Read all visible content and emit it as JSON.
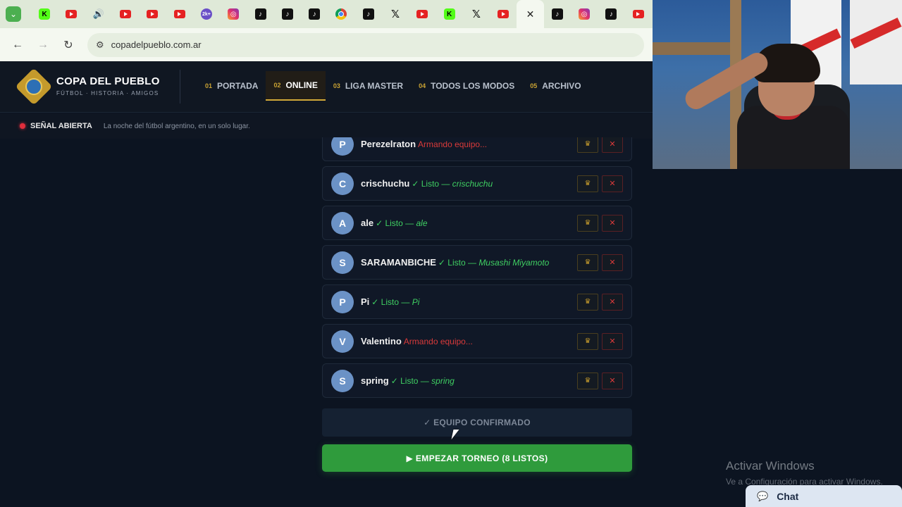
{
  "browser": {
    "tabs": [
      {
        "icon": "kick-icon",
        "type": "kick",
        "glyph": "K"
      },
      {
        "icon": "youtube-icon",
        "type": "yt",
        "glyph": ""
      },
      {
        "icon": "speaker-icon",
        "type": "spk",
        "glyph": "🔊"
      },
      {
        "icon": "youtube-icon",
        "type": "yt",
        "glyph": ""
      },
      {
        "icon": "youtube-icon",
        "type": "yt",
        "glyph": ""
      },
      {
        "icon": "youtube-icon",
        "type": "yt",
        "glyph": ""
      },
      {
        "icon": "2k-icon",
        "type": "k2",
        "glyph": "2k+"
      },
      {
        "icon": "instagram-icon",
        "type": "ig",
        "glyph": "◎"
      },
      {
        "icon": "tiktok-icon",
        "type": "tt",
        "glyph": "♪"
      },
      {
        "icon": "tiktok-icon",
        "type": "tt",
        "glyph": "♪"
      },
      {
        "icon": "tiktok-icon",
        "type": "tt",
        "glyph": "♪"
      },
      {
        "icon": "chrome-icon",
        "type": "chrome",
        "glyph": ""
      },
      {
        "icon": "tiktok-icon",
        "type": "tt",
        "glyph": "♪"
      },
      {
        "icon": "x-icon",
        "type": "x",
        "glyph": "𝕏"
      },
      {
        "icon": "youtube-icon",
        "type": "yt",
        "glyph": ""
      },
      {
        "icon": "kick-icon",
        "type": "kick",
        "glyph": "K"
      },
      {
        "icon": "x-icon",
        "type": "x",
        "glyph": "𝕏"
      },
      {
        "icon": "youtube-icon",
        "type": "yt",
        "glyph": ""
      },
      {
        "icon": "close-icon",
        "type": "close",
        "glyph": "✕",
        "active": true
      },
      {
        "icon": "tiktok-icon",
        "type": "tt",
        "glyph": "♪"
      },
      {
        "icon": "instagram-icon",
        "type": "ig",
        "glyph": "◎"
      },
      {
        "icon": "tiktok-icon",
        "type": "tt",
        "glyph": "♪"
      },
      {
        "icon": "youtube-icon",
        "type": "yt",
        "glyph": ""
      }
    ],
    "url": "copadelpueblo.com.ar"
  },
  "site": {
    "brand_title": "COPA DEL PUEBLO",
    "brand_subtitle": "FÚTBOL · HISTORIA · AMIGOS",
    "nav": [
      {
        "num": "01",
        "label": "PORTADA",
        "active": false
      },
      {
        "num": "02",
        "label": "ONLINE",
        "active": true
      },
      {
        "num": "03",
        "label": "LIGA MASTER",
        "active": false
      },
      {
        "num": "04",
        "label": "TODOS LOS MODOS",
        "active": false
      },
      {
        "num": "05",
        "label": "ARCHIVO",
        "active": false
      }
    ],
    "ticker_label": "SEÑAL ABIERTA",
    "ticker_text": "La noche del fútbol argentino, en un solo lugar."
  },
  "players": [
    {
      "initial": "P",
      "name": "Perezelraton",
      "status": "Armando equipo...",
      "ready": false,
      "team": ""
    },
    {
      "initial": "C",
      "name": "crischuchu",
      "status": "✓ Listo —",
      "ready": true,
      "team": "crischuchu"
    },
    {
      "initial": "A",
      "name": "ale",
      "status": "✓ Listo —",
      "ready": true,
      "team": "ale"
    },
    {
      "initial": "S",
      "name": "SARAMANBICHE",
      "status": "✓ Listo —",
      "ready": true,
      "team": "Musashi Miyamoto"
    },
    {
      "initial": "P",
      "name": "Pi",
      "status": "✓ Listo —",
      "ready": true,
      "team": "Pi"
    },
    {
      "initial": "V",
      "name": "Valentino",
      "status": "Armando equipo...",
      "ready": false,
      "team": ""
    },
    {
      "initial": "S",
      "name": "spring",
      "status": "✓ Listo —",
      "ready": true,
      "team": "spring"
    }
  ],
  "actions": {
    "crown_glyph": "♛",
    "kick_glyph": "✕",
    "confirm_label": "✓ EQUIPO CONFIRMADO",
    "start_label": "▶ EMPEZAR TORNEO (8 LISTOS)"
  },
  "windows": {
    "activate_title": "Activar Windows",
    "activate_sub": "Ve a Configuración para activar Windows."
  },
  "chat": {
    "label": "Chat",
    "icon": "chat-icon",
    "glyph": "💬"
  },
  "colors": {
    "accent_gold": "#c9a233",
    "ready_green": "#3fcf62",
    "waiting_red": "#d93a3a",
    "start_green": "#2f9b3c"
  }
}
